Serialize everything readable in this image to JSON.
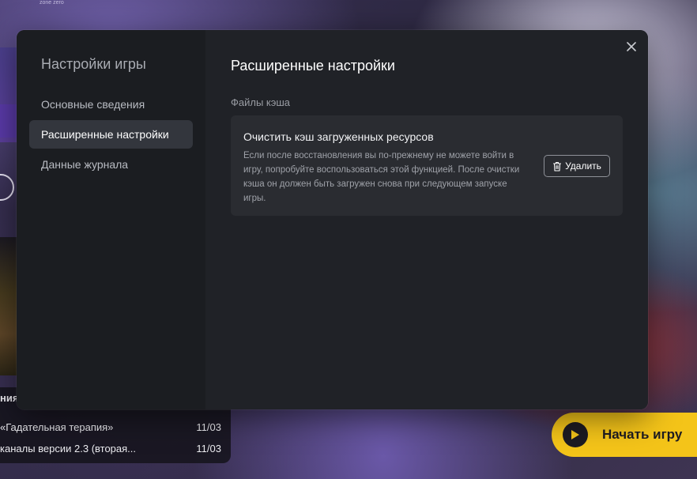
{
  "background": {
    "logo_text": "zone zero",
    "news": {
      "heading": "ния",
      "items": [
        {
          "title": "«Гадательная терапия»",
          "date": "11/03"
        },
        {
          "title": "каналы версии 2.3 (вторая...",
          "date": "11/03"
        }
      ]
    },
    "start_button": {
      "label": "Начать игру",
      "icon": "play-icon"
    }
  },
  "sidebar": {
    "title": "Настройки игры",
    "items": [
      {
        "label": "Основные сведения",
        "active": false
      },
      {
        "label": "Расширенные настройки",
        "active": true
      },
      {
        "label": "Данные журнала",
        "active": false
      }
    ]
  },
  "main": {
    "title": "Расширенные настройки",
    "close_icon": "close-icon",
    "section_label": "Файлы кэша",
    "cache_card": {
      "title": "Очистить кэш загруженных ресурсов",
      "description": "Если после восстановления вы по-прежнему не можете войти в игру, попробуйте воспользоваться этой функцией. После очистки кэша он должен быть загружен снова при следующем запуске игры.",
      "delete_label": "Удалить",
      "delete_icon": "trash-icon"
    }
  }
}
